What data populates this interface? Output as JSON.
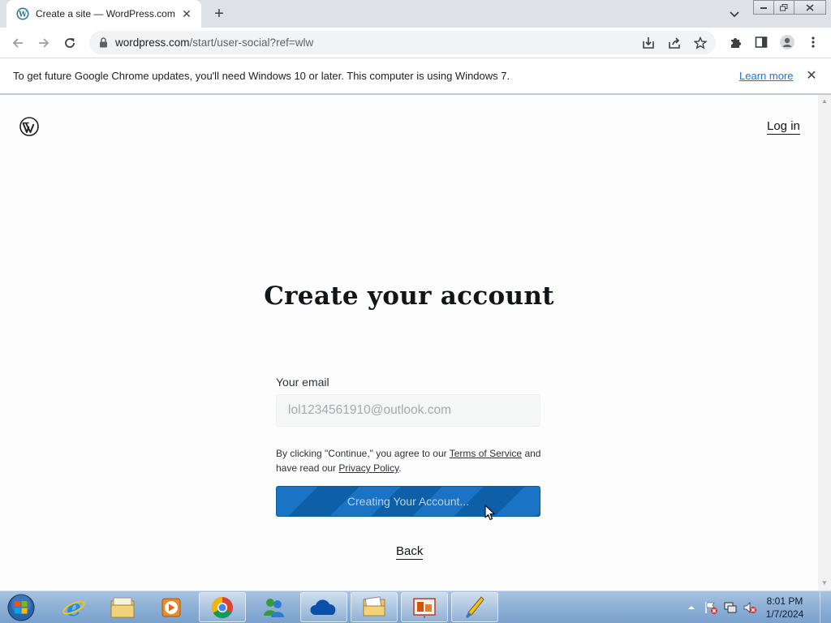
{
  "browser": {
    "tab_title": "Create a site — WordPress.com",
    "url_host": "wordpress.com",
    "url_path": "/start/user-social?ref=wlw"
  },
  "infobar": {
    "message": "To get future Google Chrome updates, you'll need Windows 10 or later. This computer is using Windows 7.",
    "link": "Learn more"
  },
  "page": {
    "login_link": "Log in",
    "heading": "Create your account",
    "email_label": "Your email",
    "email_value": "lol1234561910@outlook.com",
    "terms_prefix": "By clicking \"Continue,\" you agree to our ",
    "terms_link": "Terms of Service",
    "terms_middle": " and have read our ",
    "privacy_link": "Privacy Policy",
    "terms_suffix": ".",
    "button_label": "Creating Your Account...",
    "back_link": "Back"
  },
  "taskbar": {
    "apps": [
      "internet-explorer",
      "file-explorer",
      "media-player",
      "chrome",
      "messenger",
      "onedrive",
      "folder",
      "presentation",
      "paint"
    ],
    "clock_time": "8:01 PM",
    "clock_date": "1/7/2024"
  },
  "colors": {
    "button_primary": "#1a73c5",
    "link_blue": "#1a73e8",
    "taskbar": "#8fb1d6"
  }
}
